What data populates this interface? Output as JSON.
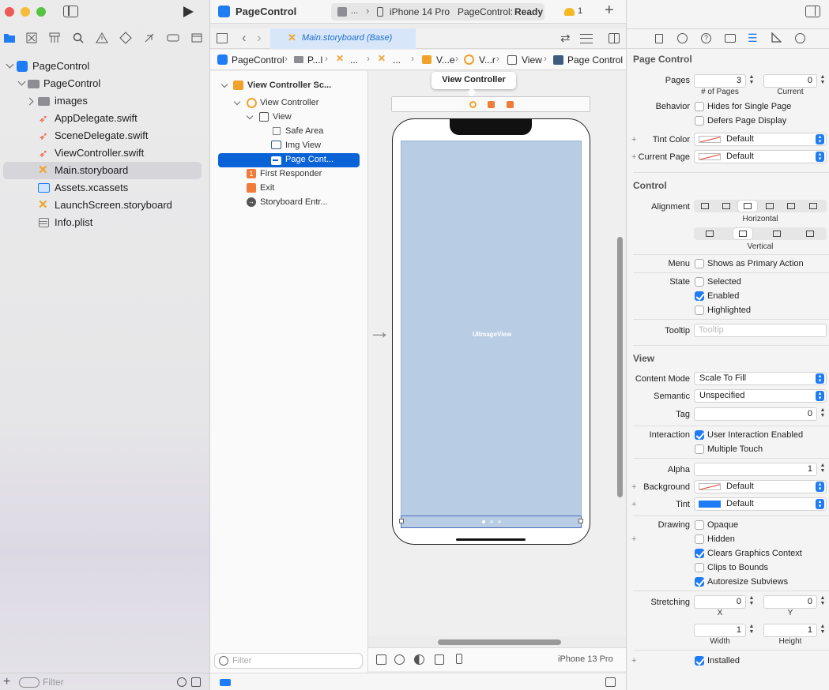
{
  "window": {
    "run_icon": "play-icon"
  },
  "sidebar": {
    "items": [
      {
        "label": "PageControl",
        "icon": "xcode-project-icon"
      },
      {
        "label": "PageControl",
        "icon": "folder-icon"
      },
      {
        "label": "images",
        "icon": "folder-icon"
      },
      {
        "label": "AppDelegate.swift",
        "icon": "swift-icon"
      },
      {
        "label": "SceneDelegate.swift",
        "icon": "swift-icon"
      },
      {
        "label": "ViewController.swift",
        "icon": "swift-icon"
      },
      {
        "label": "Main.storyboard",
        "icon": "storyboard-icon"
      },
      {
        "label": "Assets.xcassets",
        "icon": "assets-icon"
      },
      {
        "label": "LaunchScreen.storyboard",
        "icon": "storyboard-icon"
      },
      {
        "label": "Info.plist",
        "icon": "plist-icon"
      }
    ],
    "filter_placeholder": "Filter"
  },
  "toolbar": {
    "project": "PageControl",
    "scheme_short": "...",
    "device": "iPhone 14 Pro",
    "status_prefix": "PageControl:",
    "status": "Ready",
    "warnings": "1"
  },
  "tab": {
    "label": "Main.storyboard (Base)"
  },
  "breadcrumb": [
    "PageControl",
    "P...l",
    "...",
    "...",
    "V...e",
    "V...r",
    "View",
    "Page Control"
  ],
  "outline": [
    {
      "label": "View Controller Sc...",
      "bold": true
    },
    {
      "label": "View Controller"
    },
    {
      "label": "View"
    },
    {
      "label": "Safe Area"
    },
    {
      "label": "Img View"
    },
    {
      "label": "Page Cont..."
    },
    {
      "label": "First Responder"
    },
    {
      "label": "Exit"
    },
    {
      "label": "Storyboard Entr..."
    }
  ],
  "canvas": {
    "scene_title": "View Controller",
    "image_view_label": "UIImageView",
    "device_label": "iPhone 13 Pro",
    "filter_placeholder": "Filter"
  },
  "inspector": {
    "page_control": {
      "title": "Page Control",
      "pages_label": "Pages",
      "pages_value": "3",
      "pages_sub": "# of Pages",
      "current_value": "0",
      "current_sub": "Current",
      "behavior_label": "Behavior",
      "hides_single": "Hides for Single Page",
      "defers": "Defers Page Display",
      "tint_color_label": "Tint Color",
      "tint_color_value": "Default",
      "current_page_label": "Current Page",
      "current_page_value": "Default"
    },
    "control": {
      "title": "Control",
      "alignment_label": "Alignment",
      "horizontal": "Horizontal",
      "vertical": "Vertical",
      "menu_label": "Menu",
      "primary_action": "Shows as Primary Action",
      "state_label": "State",
      "selected": "Selected",
      "enabled": "Enabled",
      "highlighted": "Highlighted",
      "tooltip_label": "Tooltip",
      "tooltip_placeholder": "Tooltip"
    },
    "view": {
      "title": "View",
      "content_mode_label": "Content Mode",
      "content_mode_value": "Scale To Fill",
      "semantic_label": "Semantic",
      "semantic_value": "Unspecified",
      "tag_label": "Tag",
      "tag_value": "0",
      "interaction_label": "Interaction",
      "user_interaction": "User Interaction Enabled",
      "multiple_touch": "Multiple Touch",
      "alpha_label": "Alpha",
      "alpha_value": "1",
      "background_label": "Background",
      "background_value": "Default",
      "tint_label": "Tint",
      "tint_value": "Default",
      "tint_color": "#1f7cf5",
      "drawing_label": "Drawing",
      "opaque": "Opaque",
      "hidden": "Hidden",
      "clears": "Clears Graphics Context",
      "clips": "Clips to Bounds",
      "autoresize": "Autoresize Subviews",
      "stretching_label": "Stretching",
      "x_value": "0",
      "x_sub": "X",
      "y_value": "0",
      "y_sub": "Y",
      "width_value": "1",
      "width_sub": "Width",
      "height_value": "1",
      "height_sub": "Height",
      "installed": "Installed"
    }
  },
  "colors": {
    "accent": "#1f7cf5",
    "selection": "#0a63d6",
    "image_view": "#b8cce4"
  }
}
